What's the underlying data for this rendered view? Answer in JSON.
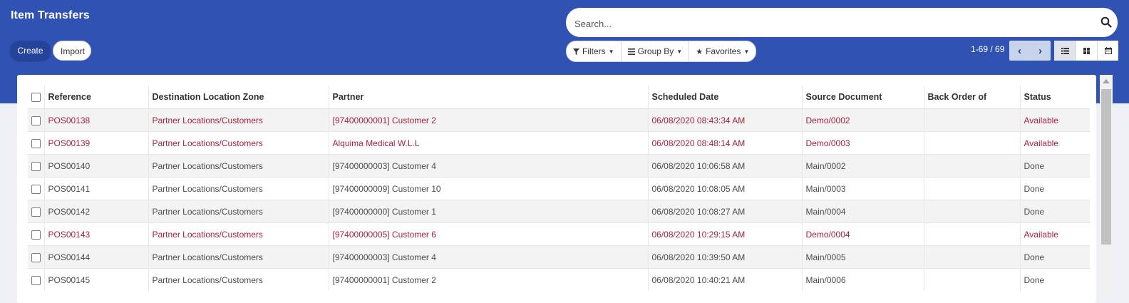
{
  "header": {
    "title": "Item Transfers",
    "create_label": "Create",
    "import_label": "Import"
  },
  "search": {
    "placeholder": "Search..."
  },
  "filters": {
    "filters_label": "Filters",
    "group_by_label": "Group By",
    "favorites_label": "Favorites"
  },
  "pager": {
    "value": "1-69 / 69"
  },
  "colors": {
    "topbar": "#3052b3",
    "available_text": "#a3223c"
  },
  "table": {
    "columns": [
      "Reference",
      "Destination Location Zone",
      "Partner",
      "Scheduled Date",
      "Source Document",
      "Back Order of",
      "Status"
    ],
    "rows": [
      {
        "ref": "POS00138",
        "zone": "Partner Locations/Customers",
        "partner": "[97400000001] Customer 2",
        "date": "06/08/2020 08:43:34 AM",
        "source": "Demo/0002",
        "backorder": "",
        "status": "Available"
      },
      {
        "ref": "POS00139",
        "zone": "Partner Locations/Customers",
        "partner": "Alquima Medical W.L.L",
        "date": "06/08/2020 08:48:14 AM",
        "source": "Demo/0003",
        "backorder": "",
        "status": "Available"
      },
      {
        "ref": "POS00140",
        "zone": "Partner Locations/Customers",
        "partner": "[97400000003] Customer 4",
        "date": "06/08/2020 10:06:58 AM",
        "source": "Main/0002",
        "backorder": "",
        "status": "Done"
      },
      {
        "ref": "POS00141",
        "zone": "Partner Locations/Customers",
        "partner": "[97400000009] Customer 10",
        "date": "06/08/2020 10:08:05 AM",
        "source": "Main/0003",
        "backorder": "",
        "status": "Done"
      },
      {
        "ref": "POS00142",
        "zone": "Partner Locations/Customers",
        "partner": "[97400000000] Customer 1",
        "date": "06/08/2020 10:08:27 AM",
        "source": "Main/0004",
        "backorder": "",
        "status": "Done"
      },
      {
        "ref": "POS00143",
        "zone": "Partner Locations/Customers",
        "partner": "[97400000005] Customer 6",
        "date": "06/08/2020 10:29:15 AM",
        "source": "Demo/0004",
        "backorder": "",
        "status": "Available"
      },
      {
        "ref": "POS00144",
        "zone": "Partner Locations/Customers",
        "partner": "[97400000003] Customer 4",
        "date": "06/08/2020 10:39:50 AM",
        "source": "Main/0005",
        "backorder": "",
        "status": "Done"
      },
      {
        "ref": "POS00145",
        "zone": "Partner Locations/Customers",
        "partner": "[97400000001] Customer 2",
        "date": "06/08/2020 10:40:21 AM",
        "source": "Main/0006",
        "backorder": "",
        "status": "Done"
      }
    ]
  }
}
